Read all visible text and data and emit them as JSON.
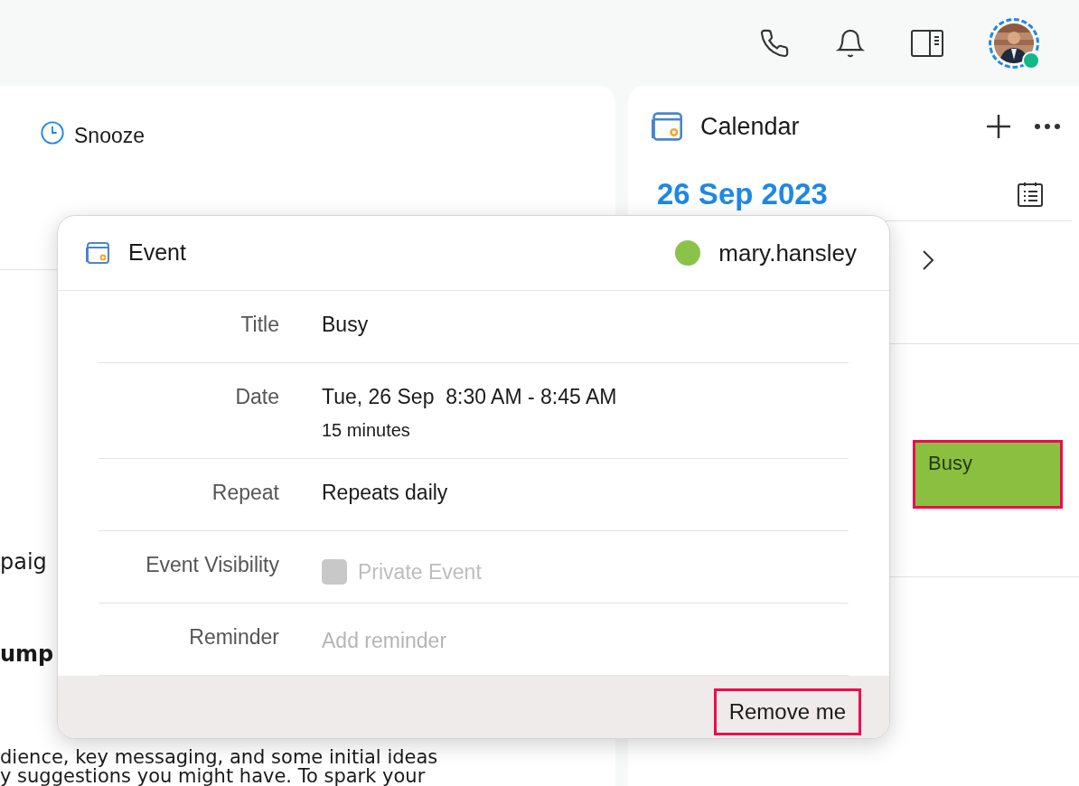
{
  "avatar": {
    "kind": "picture",
    "online": true
  },
  "left_panel": {
    "snooze_label": "Snooze",
    "fragments": [
      {
        "text": "paig",
        "bold": false
      },
      {
        "text": "ump",
        "bold": true
      },
      {
        "text": "dience, key messaging, and some initial ideas",
        "bold": false
      },
      {
        "text": "y suggestions you might have. To spark your",
        "bold": false
      }
    ]
  },
  "calendar": {
    "title": "Calendar",
    "date": "26 Sep 2023",
    "event": {
      "title": "Busy",
      "color": "#8bbf3f",
      "highlighted": true
    }
  },
  "popover": {
    "title": "Event",
    "organizer": {
      "name": "mary.hansley",
      "color": "#8bc34a"
    },
    "fields": [
      {
        "kind": "text",
        "label": "Title",
        "value": "Busy"
      },
      {
        "kind": "date",
        "label": "Date",
        "value": "Tue, 26 Sep  8:30 AM - 8:45 AM",
        "detail": "15 minutes"
      },
      {
        "kind": "text",
        "label": "Repeat",
        "value": "Repeats daily"
      },
      {
        "kind": "checkbox",
        "label": "Event Visibility",
        "value": "Private Event",
        "checked": false,
        "disabled": true
      },
      {
        "kind": "placeholder",
        "label": "Reminder",
        "placeholder": "Add reminder"
      }
    ],
    "footer_button": {
      "label": "Remove me",
      "highlighted": true
    }
  }
}
